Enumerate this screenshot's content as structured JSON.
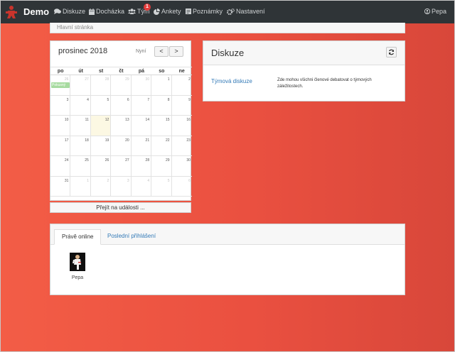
{
  "app": {
    "brand": "Demo"
  },
  "nav": {
    "items": [
      {
        "label": "Diskuze",
        "icon": "comments-icon"
      },
      {
        "label": "Docházka",
        "icon": "calendar-icon"
      },
      {
        "label": "Tým",
        "icon": "team-icon",
        "badge": "1"
      },
      {
        "label": "Ankety",
        "icon": "pie-chart-icon"
      },
      {
        "label": "Poznámky",
        "icon": "notes-icon"
      },
      {
        "label": "Nastavení",
        "icon": "cogs-icon"
      }
    ],
    "user": {
      "label": "Pepa",
      "icon": "user-icon"
    }
  },
  "breadcrumb": {
    "label": "Hlavní stránka"
  },
  "calendar": {
    "title": "prosinec 2018",
    "now_label": "Nyní",
    "prev_label": "<",
    "next_label": ">",
    "weekdays": [
      "po",
      "út",
      "st",
      "čt",
      "pá",
      "so",
      "ne"
    ],
    "weeks": [
      [
        {
          "d": "26",
          "o": true
        },
        {
          "d": "27",
          "o": true
        },
        {
          "d": "28",
          "o": true
        },
        {
          "d": "29",
          "o": true
        },
        {
          "d": "30",
          "o": true
        },
        {
          "d": "1"
        },
        {
          "d": "2"
        }
      ],
      [
        {
          "d": "3"
        },
        {
          "d": "4"
        },
        {
          "d": "5"
        },
        {
          "d": "6"
        },
        {
          "d": "7"
        },
        {
          "d": "8"
        },
        {
          "d": "9"
        }
      ],
      [
        {
          "d": "10"
        },
        {
          "d": "11"
        },
        {
          "d": "12",
          "today": true
        },
        {
          "d": "13"
        },
        {
          "d": "14"
        },
        {
          "d": "15"
        },
        {
          "d": "16"
        }
      ],
      [
        {
          "d": "17"
        },
        {
          "d": "18"
        },
        {
          "d": "19"
        },
        {
          "d": "20"
        },
        {
          "d": "21"
        },
        {
          "d": "22"
        },
        {
          "d": "23"
        }
      ],
      [
        {
          "d": "24"
        },
        {
          "d": "25"
        },
        {
          "d": "26"
        },
        {
          "d": "27"
        },
        {
          "d": "28"
        },
        {
          "d": "29"
        },
        {
          "d": "30"
        }
      ],
      [
        {
          "d": "31"
        },
        {
          "d": "1",
          "o": true
        },
        {
          "d": "2",
          "o": true
        },
        {
          "d": "3",
          "o": true
        },
        {
          "d": "4",
          "o": true
        },
        {
          "d": "5",
          "o": true
        },
        {
          "d": "6",
          "o": true
        }
      ]
    ],
    "event_label": "Pokusný",
    "event_color": "#a7dba0",
    "go_events_label": "Přejít na události ..."
  },
  "discussion": {
    "title": "Diskuze",
    "refresh_icon": "refresh-icon",
    "link_label": "Týmová diskuze",
    "description": "Zde mohou všichni členové debatovat o týmových záležitostech."
  },
  "online": {
    "tabs": [
      {
        "label": "Právě online",
        "active": true
      },
      {
        "label": "Poslední přihlášení",
        "active": false
      }
    ],
    "users": [
      {
        "name": "Pepa"
      }
    ]
  },
  "colors": {
    "navbar": "#2f3437",
    "link": "#337ab7",
    "badge": "#e23b3b",
    "background_start": "#f35d46",
    "background_end": "#d8473a"
  }
}
